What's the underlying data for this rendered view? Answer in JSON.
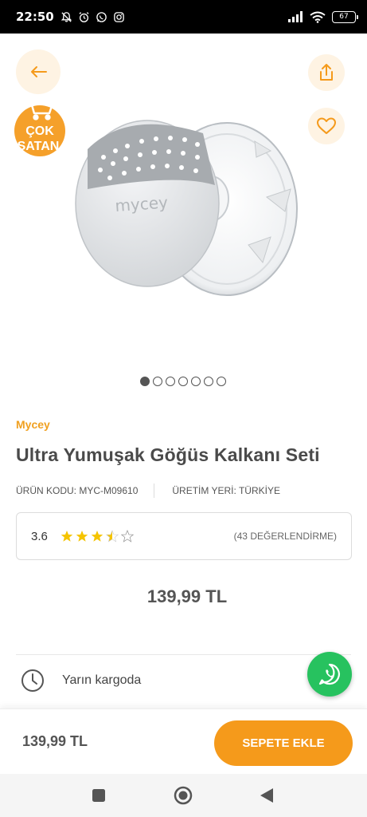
{
  "status_bar": {
    "time": "22:50",
    "battery": "67"
  },
  "gallery": {
    "badge_line1": "ÇOK",
    "badge_line2": "SATAN",
    "product_logo": "mycey",
    "image_count": 7,
    "active_index": 0
  },
  "product": {
    "brand": "Mycey",
    "title": "Ultra Yumuşak Göğüs Kalkanı Seti",
    "code_label": "ÜRÜN KODU: MYC-M09610",
    "origin_label": "ÜRETİM YERİ: TÜRKİYE",
    "rating": {
      "score": "3.6",
      "stars_value": 3.5,
      "count_label": "(43 DEĞERLENDİRME)"
    },
    "price": "139,99 TL"
  },
  "shipping": {
    "text": "Yarın kargoda"
  },
  "bottom_bar": {
    "price": "139,99 TL",
    "cart_button": "SEPETE EKLE"
  },
  "colors": {
    "accent": "#f59a1b",
    "brand_text": "#f0a020",
    "whatsapp": "#27c25f"
  },
  "icons": {
    "back": "arrow-left-icon",
    "share": "share-icon",
    "favorite": "heart-icon",
    "shipping": "clock-icon",
    "chat": "whatsapp-icon"
  }
}
